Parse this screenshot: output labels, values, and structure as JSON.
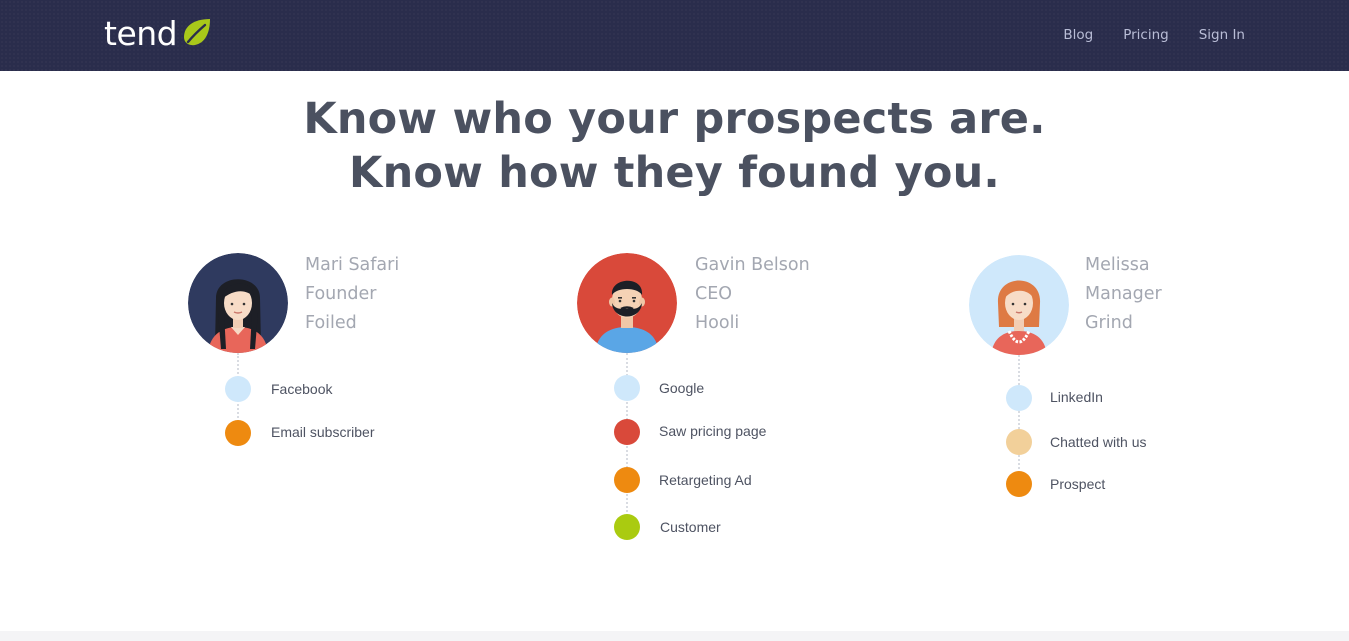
{
  "header": {
    "logo_text": "tend",
    "nav": [
      "Blog",
      "Pricing",
      "Sign In"
    ]
  },
  "hero": {
    "line1": "Know who your prospects are.",
    "line2": "Know how they found you."
  },
  "people": [
    {
      "name": "Mari Safari",
      "title": "Founder",
      "company": "Foiled",
      "events": [
        "Facebook",
        "Email subscriber"
      ]
    },
    {
      "name": "Gavin Belson",
      "title": "CEO",
      "company": "Hooli",
      "events": [
        "Google",
        "Saw pricing page",
        "Retargeting Ad",
        "Customer"
      ]
    },
    {
      "name": "Melissa",
      "title": "Manager",
      "company": "Grind",
      "events": [
        "LinkedIn",
        "Chatted with us",
        "Prospect"
      ]
    }
  ],
  "colors": {
    "header_bg": "#2a2d4c",
    "leaf_green": "#a9c81a",
    "light_blue": "#cfe8fb",
    "orange": "#ee8a10",
    "red": "#d9493a",
    "lime": "#aacb10",
    "tan": "#f2d09a"
  }
}
